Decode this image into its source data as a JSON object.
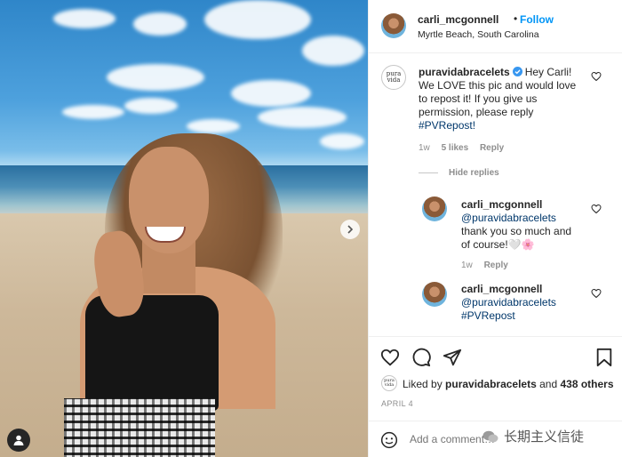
{
  "post": {
    "author": "carli_mcgonnell",
    "follow_label": "Follow",
    "separator": "•",
    "location": "Myrtle Beach, South Carolina"
  },
  "comments": [
    {
      "user": "puravidabracelets",
      "avatar_text": "pura vida",
      "verified": true,
      "text": "Hey Carli! We LOVE this pic and would love to repost it! If you give us permission, please reply",
      "tag": "#PVRepost!",
      "time": "1w",
      "likes": "5 likes",
      "reply_label": "Reply"
    }
  ],
  "hide_replies_label": "Hide replies",
  "replies": [
    {
      "user": "carli_mcgonnell",
      "mention": "@puravidabracelets",
      "text": "thank you so much and of course!",
      "emoji": "🤍🌸",
      "time": "1w",
      "reply_label": "Reply"
    },
    {
      "user": "carli_mcgonnell",
      "mention": "@puravidabracelets",
      "tag": "#PVRepost"
    }
  ],
  "likes": {
    "prefix": "Liked by",
    "user": "puravidabracelets",
    "joiner": "and",
    "others": "438 others",
    "avatar_text": "pura vida"
  },
  "date": "APRIL 4",
  "add_comment": {
    "placeholder": "Add a comment…",
    "post_label": "Post"
  },
  "watermark": "长期主义信徒",
  "colors": {
    "link_blue": "#0095f6",
    "mention": "#00376b",
    "muted": "#8e8e8e",
    "border": "#efefef"
  },
  "icons": [
    "heart-icon",
    "comment-icon",
    "share-icon",
    "bookmark-icon",
    "emoji-icon",
    "chevron-right-icon",
    "user-tag-icon",
    "verified-badge-icon"
  ]
}
